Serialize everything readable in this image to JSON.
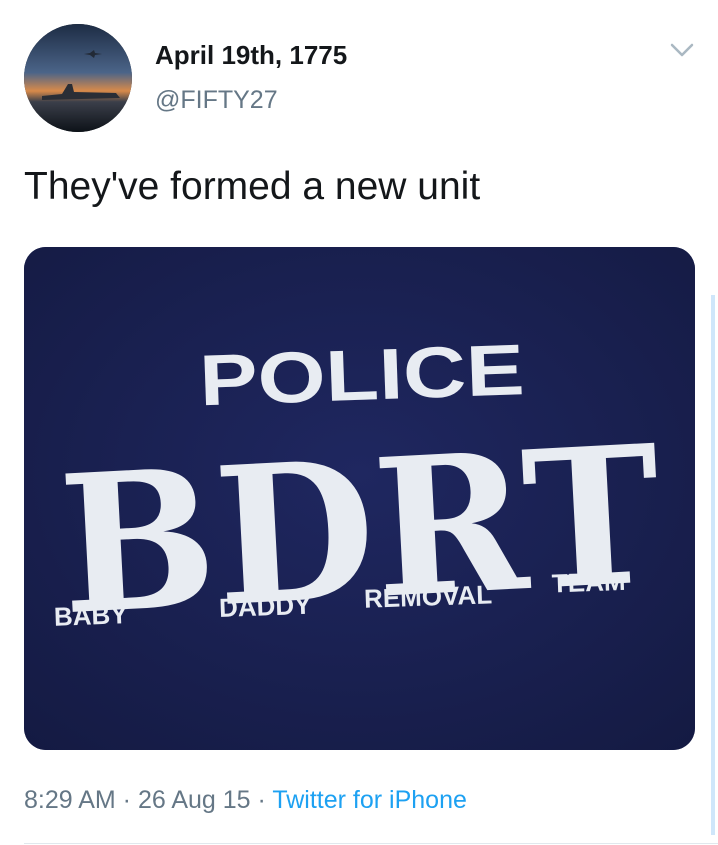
{
  "tweet": {
    "display_name": "April 19th, 1775",
    "handle": "@FIFTY27",
    "text": "They've formed a new unit",
    "time": "8:29 AM",
    "separator": " · ",
    "date": "26 Aug 15",
    "source": "Twitter for iPhone"
  },
  "media": {
    "shirt_text": {
      "line1": "POLICE",
      "line2": "BDRT",
      "words": [
        "BABY",
        "DADDY",
        "REMOVAL",
        "TEAM"
      ]
    },
    "shirt_color": "#1a2050"
  },
  "icons": {
    "menu": "chevron-down-icon"
  },
  "colors": {
    "text": "#14171a",
    "secondary": "#657786",
    "link": "#1da1f2"
  }
}
